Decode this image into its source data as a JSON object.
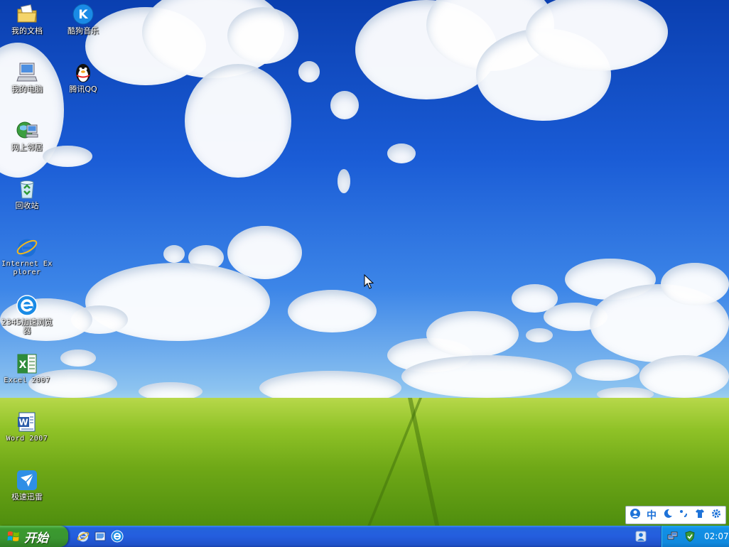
{
  "desktop": {
    "icons": [
      {
        "label": "我的文档",
        "icon": "my-documents-icon"
      },
      {
        "label": "酷狗音乐",
        "icon": "kugou-music-icon"
      },
      {
        "label": "我的电脑",
        "icon": "my-computer-icon"
      },
      {
        "label": "腾讯QQ",
        "icon": "qq-penguin-icon"
      },
      {
        "label": "网上邻居",
        "icon": "network-places-icon"
      },
      {
        "label": "回收站",
        "icon": "recycle-bin-icon"
      },
      {
        "label": "Internet Explorer",
        "icon": "internet-explorer-icon"
      },
      {
        "label": "2345加速浏览器",
        "icon": "browser-2345-icon"
      },
      {
        "label": "Excel 2007",
        "icon": "excel-icon"
      },
      {
        "label": "Word 2007",
        "icon": "word-icon"
      },
      {
        "label": "极速迅雷",
        "icon": "xunlei-icon"
      }
    ]
  },
  "ime": {
    "mode": "中"
  },
  "taskbar": {
    "start_label": "开始",
    "clock": "02:07"
  },
  "colors": {
    "taskbar_blue": "#245ede",
    "start_green": "#3a9530",
    "tray_blue": "#1089de"
  }
}
